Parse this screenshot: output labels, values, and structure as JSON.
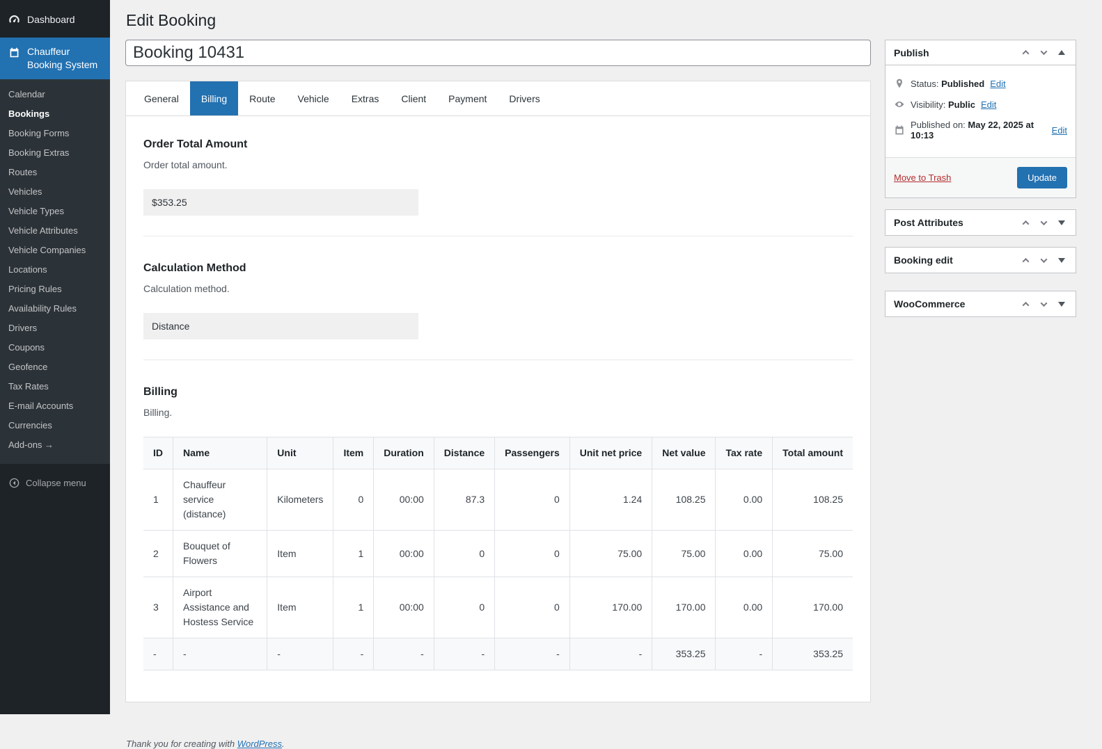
{
  "sidebar": {
    "dashboard_label": "Dashboard",
    "plugin_label": "Chauffeur Booking System",
    "items": [
      "Calendar",
      "Bookings",
      "Booking Forms",
      "Booking Extras",
      "Routes",
      "Vehicles",
      "Vehicle Types",
      "Vehicle Attributes",
      "Vehicle Companies",
      "Locations",
      "Pricing Rules",
      "Availability Rules",
      "Drivers",
      "Coupons",
      "Geofence",
      "Tax Rates",
      "E-mail Accounts",
      "Currencies",
      "Add-ons →"
    ],
    "active_item": "Bookings",
    "collapse_label": "Collapse menu"
  },
  "header": {
    "title": "Edit Booking"
  },
  "title_field": {
    "value": "Booking 10431"
  },
  "tabs": {
    "items": [
      "General",
      "Billing",
      "Route",
      "Vehicle",
      "Extras",
      "Client",
      "Payment",
      "Drivers"
    ],
    "active": "Billing"
  },
  "sections": {
    "order_total": {
      "title": "Order Total Amount",
      "desc": "Order total amount.",
      "value": "$353.25"
    },
    "calc_method": {
      "title": "Calculation Method",
      "desc": "Calculation method.",
      "value": "Distance"
    },
    "billing": {
      "title": "Billing",
      "desc": "Billing."
    }
  },
  "billing_table": {
    "headers": [
      "ID",
      "Name",
      "Unit",
      "Item",
      "Duration",
      "Distance",
      "Passengers",
      "Unit net price",
      "Net value",
      "Tax rate",
      "Total amount"
    ],
    "rows": [
      [
        "1",
        "Chauffeur service (distance)",
        "Kilometers",
        "0",
        "00:00",
        "87.3",
        "0",
        "1.24",
        "108.25",
        "0.00",
        "108.25"
      ],
      [
        "2",
        "Bouquet of Flowers",
        "Item",
        "1",
        "00:00",
        "0",
        "0",
        "75.00",
        "75.00",
        "0.00",
        "75.00"
      ],
      [
        "3",
        "Airport Assistance and Hostess Service",
        "Item",
        "1",
        "00:00",
        "0",
        "0",
        "170.00",
        "170.00",
        "0.00",
        "170.00"
      ],
      [
        "-",
        "-",
        "-",
        "-",
        "-",
        "-",
        "-",
        "-",
        "353.25",
        "-",
        "353.25"
      ]
    ]
  },
  "publish": {
    "title": "Publish",
    "status_label": "Status:",
    "status_value": "Published",
    "visibility_label": "Visibility:",
    "visibility_value": "Public",
    "published_label": "Published on:",
    "published_value": "May 22, 2025 at 10:13",
    "edit_label": "Edit",
    "trash_label": "Move to Trash",
    "update_label": "Update"
  },
  "metaboxes": [
    {
      "title": "Post Attributes"
    },
    {
      "title": "Booking edit"
    },
    {
      "title": "WooCommerce"
    }
  ],
  "footer": {
    "pre": "Thank you for creating with ",
    "link": "WordPress",
    "post": "."
  },
  "colors": {
    "accent": "#2271b1",
    "sidebar_bg": "#1d2327",
    "submenu_bg": "#2c3338",
    "danger": "#b32d2e"
  }
}
